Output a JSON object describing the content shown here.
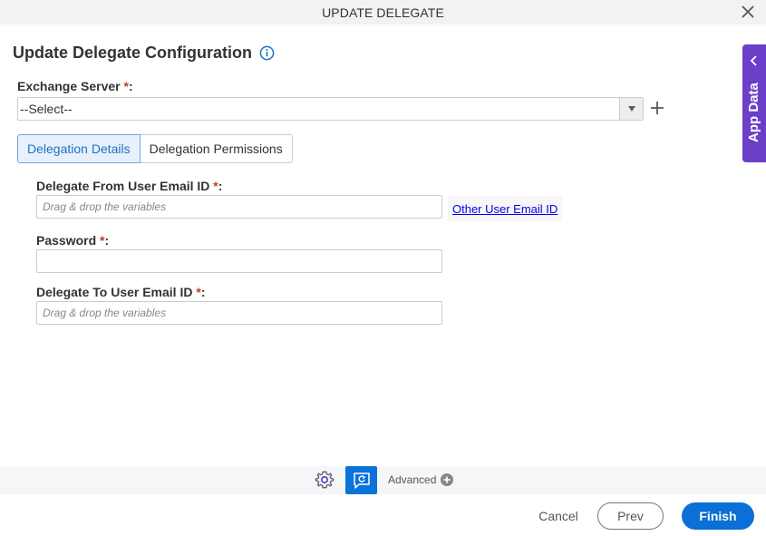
{
  "dialog": {
    "title": "UPDATE DELEGATE",
    "close_icon": "close-icon"
  },
  "heading": {
    "text": "Update Delegate Configuration",
    "info_icon": "info-icon"
  },
  "exchange_server": {
    "label": "Exchange Server ",
    "required_mark": "*",
    "suffix": ":",
    "selected": "--Select--",
    "add_icon": "plus-icon"
  },
  "tabs": [
    {
      "label": "Delegation Details",
      "active": true
    },
    {
      "label": "Delegation Permissions",
      "active": false
    }
  ],
  "fields": {
    "from_email": {
      "label": "Delegate From User Email ID ",
      "required_mark": "*",
      "suffix": ":",
      "placeholder": "Drag & drop the variables",
      "link": "Other User Email ID"
    },
    "password": {
      "label": "Password ",
      "required_mark": "*",
      "suffix": ":",
      "value": ""
    },
    "to_email": {
      "label": "Delegate To User Email ID ",
      "required_mark": "*",
      "suffix": ":",
      "placeholder": "Drag & drop the variables"
    }
  },
  "side_panel": {
    "label": "App Data"
  },
  "bottom_toolbar": {
    "advanced_label": "Advanced"
  },
  "footer": {
    "cancel": "Cancel",
    "prev": "Prev",
    "finish": "Finish"
  },
  "colors": {
    "accent": "#0a6fd6",
    "app_data": "#6c3fc9",
    "required": "#c0392b",
    "link": "#0000ee"
  }
}
